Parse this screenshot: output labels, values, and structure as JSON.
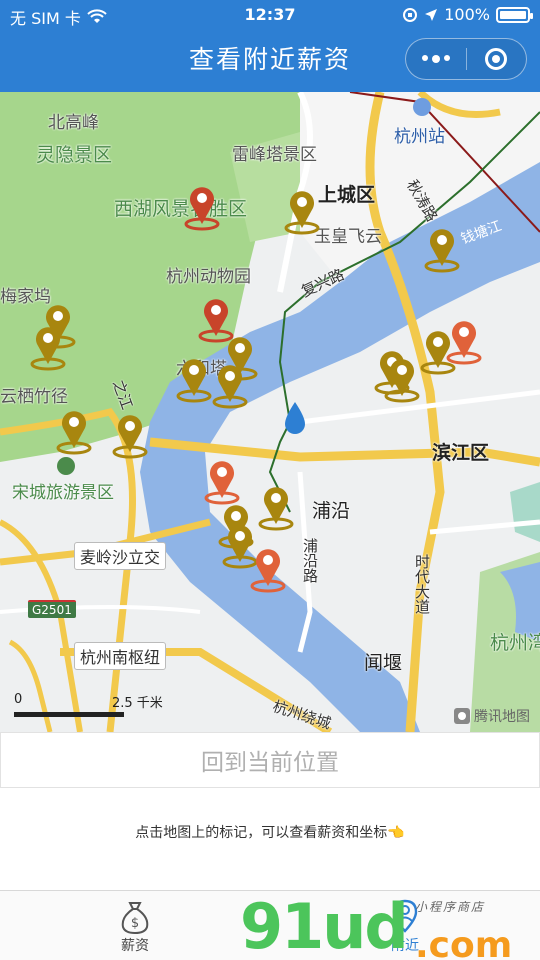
{
  "status_bar": {
    "carrier": "无 SIM 卡",
    "time": "12:37",
    "battery_percent": "100%",
    "battery_level": 1.0
  },
  "header": {
    "title": "查看附近薪资",
    "menu_icon": "more-dots-icon",
    "close_icon": "target-circle-icon",
    "color": "#2d7fd3"
  },
  "map": {
    "labels": {
      "beigaofeng": "北高峰",
      "lingyin": "灵隐景区",
      "xihu": "西湖风景名胜区",
      "leifengta": "雷峰塔景区",
      "shangcheng": "上城区",
      "yuhuang": "玉皇飞云",
      "zoo": "杭州动物园",
      "hangzhou_station": "杭州站",
      "qiantang": "钱塘江",
      "fuxing": "复兴路",
      "qiutao": "秋涛路",
      "meijiawu": "梅家坞",
      "yunqi": "云栖竹径",
      "liuhe": "六和塔",
      "binjiang": "滨江区",
      "songcheng": "宋城旅游景区",
      "puyan": "浦沿",
      "puyan_road": "浦沿路",
      "shidai": "时代大道",
      "zhijiang": "之江",
      "hangzhou_east": "杭州湾",
      "wenyan": "闻堰",
      "ring_road": "杭州绕城"
    },
    "road_boxes": {
      "mailingsha": "麦岭沙立交",
      "hub": "杭州南枢纽"
    },
    "highway_badge": "G2501",
    "scale": {
      "zero": "0",
      "distance": "2.5 千米"
    },
    "attribution": "腾讯地图",
    "pin_colors": {
      "red": "#c8442a",
      "orange": "#e0623a",
      "gold": "#a8860f"
    }
  },
  "locate_button": "回到当前位置",
  "hint": "点击地图上的标记，可以查看薪资和坐标👈",
  "tabbar": {
    "items": [
      {
        "label": "薪资",
        "icon": "money-bag-icon"
      },
      {
        "label": "附近",
        "icon": "location-person-icon"
      }
    ]
  },
  "watermark": {
    "brand": "91ud",
    "suffix": ".com",
    "tagline": "小程序商店"
  }
}
